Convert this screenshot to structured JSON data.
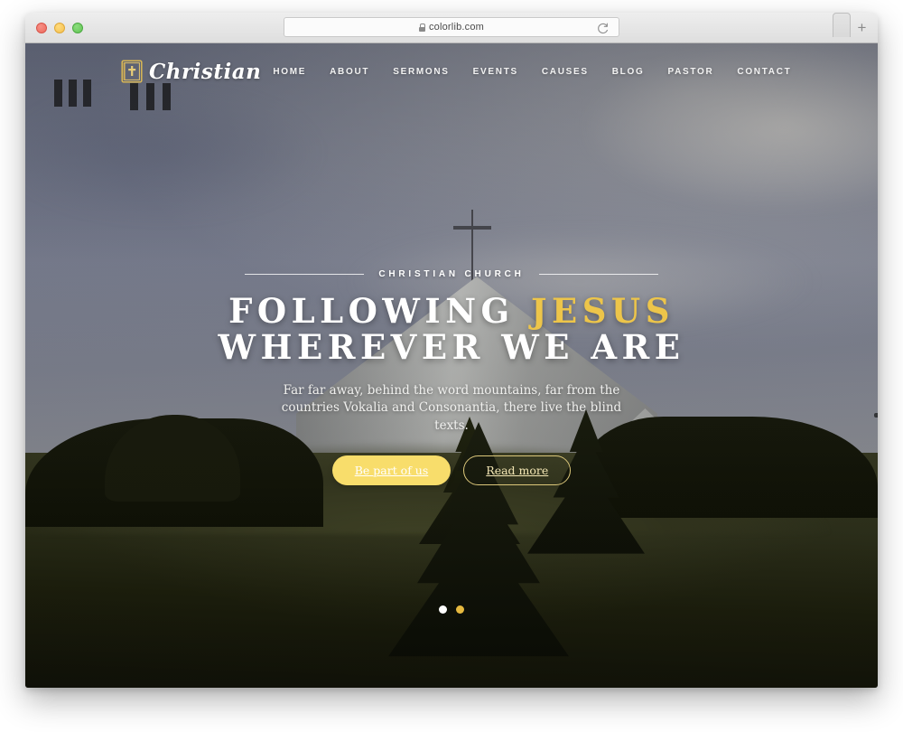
{
  "browser": {
    "url": "colorlib.com",
    "lock_icon": "lock-icon",
    "reload_icon": "reload-icon",
    "newtab_icon": "plus-icon",
    "traffic_lights": [
      {
        "name": "close",
        "color": "#ed6a5e"
      },
      {
        "name": "minimize",
        "color": "#f5c04f"
      },
      {
        "name": "zoom",
        "color": "#61c454"
      }
    ]
  },
  "site": {
    "brand": {
      "name": "Christian",
      "icon": "bible-book-icon"
    },
    "nav": [
      {
        "label": "HOME"
      },
      {
        "label": "ABOUT"
      },
      {
        "label": "SERMONS"
      },
      {
        "label": "EVENTS"
      },
      {
        "label": "CAUSES"
      },
      {
        "label": "BLOG"
      },
      {
        "label": "PASTOR"
      },
      {
        "label": "CONTACT"
      }
    ],
    "hero": {
      "eyebrow": "CHRISTIAN CHURCH",
      "title_line1_plain": "FOLLOWING ",
      "title_line1_accent": "JESUS",
      "title_line2": "WHEREVER WE ARE",
      "paragraph": "Far far away, behind the word mountains, far from the countries Vokalia and Consonantia, there live the blind texts.",
      "primary_button": "Be part of us",
      "secondary_button": "Read more"
    },
    "carousel": {
      "dots": [
        {
          "name": "slide-1",
          "state": "inactive",
          "color": "#ffffff"
        },
        {
          "name": "slide-2",
          "state": "active",
          "color": "#e6b93f"
        }
      ]
    }
  },
  "colors": {
    "accent_gold": "#edc54a",
    "button_yellow": "#f8dd6b",
    "button_outline": "#dcc77a",
    "text_white": "#ffffff",
    "sky_gray": "#7c8194",
    "grass_dark": "#23250f"
  }
}
